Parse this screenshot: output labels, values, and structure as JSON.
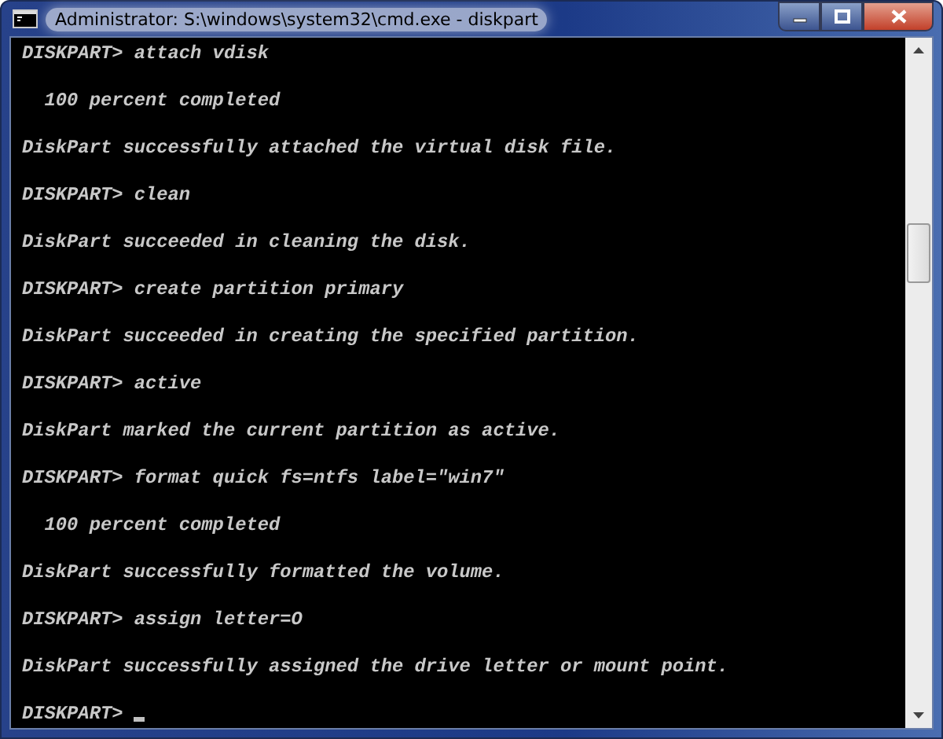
{
  "window": {
    "title": "Administrator: S:\\windows\\system32\\cmd.exe - diskpart"
  },
  "console": {
    "lines": [
      {
        "text": "DISKPART> attach vdisk"
      },
      {
        "text": "  100 percent completed"
      },
      {
        "text": "DiskPart successfully attached the virtual disk file."
      },
      {
        "text": "DISKPART> clean"
      },
      {
        "text": "DiskPart succeeded in cleaning the disk."
      },
      {
        "text": "DISKPART> create partition primary"
      },
      {
        "text": "DiskPart succeeded in creating the specified partition."
      },
      {
        "text": "DISKPART> active"
      },
      {
        "text": "DiskPart marked the current partition as active."
      },
      {
        "text": "DISKPART> format quick fs=ntfs label=\"win7\""
      },
      {
        "text": "  100 percent completed"
      },
      {
        "text": "DiskPart successfully formatted the volume."
      },
      {
        "text": "DISKPART> assign letter=O"
      },
      {
        "text": "DiskPart successfully assigned the drive letter or mount point."
      }
    ],
    "prompt": "DISKPART>"
  }
}
